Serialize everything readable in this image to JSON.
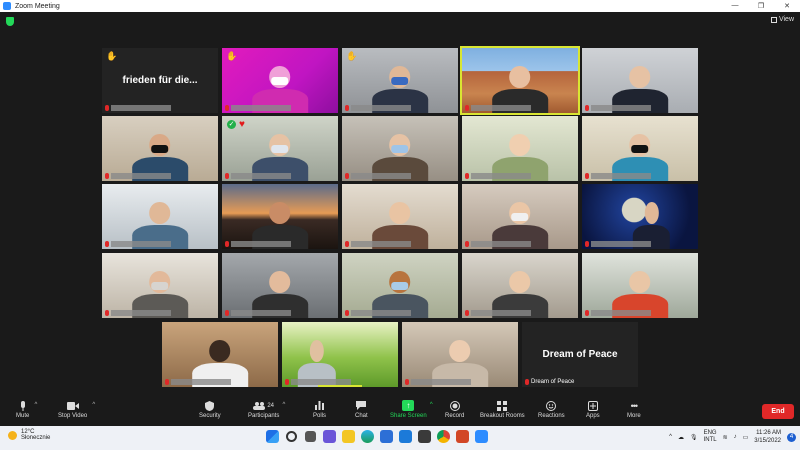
{
  "window": {
    "title": "Zoom Meeting"
  },
  "top_bar": {
    "view_label": "View"
  },
  "tiles": [
    {
      "id": "t1",
      "text": "frieden für die...",
      "hand": true
    },
    {
      "id": "t2",
      "hand": true
    },
    {
      "id": "t3",
      "hand": true
    },
    {
      "id": "t4",
      "active": true
    },
    {
      "id": "t5"
    },
    {
      "id": "t6"
    },
    {
      "id": "t7",
      "reactions": true
    },
    {
      "id": "t8"
    },
    {
      "id": "t9"
    },
    {
      "id": "t10"
    },
    {
      "id": "t11"
    },
    {
      "id": "t12"
    },
    {
      "id": "t13"
    },
    {
      "id": "t14"
    },
    {
      "id": "t15"
    },
    {
      "id": "t16"
    },
    {
      "id": "t17"
    },
    {
      "id": "t18"
    },
    {
      "id": "t19"
    },
    {
      "id": "t20"
    },
    {
      "id": "t21"
    },
    {
      "id": "t22"
    },
    {
      "id": "t23"
    },
    {
      "id": "t24",
      "text": "Dream of Peace",
      "name": "Dream of Peace"
    }
  ],
  "toolbar": {
    "mute": "Mute",
    "stop_video": "Stop Video",
    "security": "Security",
    "participants": "Participants",
    "participants_count": "24",
    "polls": "Polls",
    "chat": "Chat",
    "share_screen": "Share Screen",
    "record": "Record",
    "breakout_rooms": "Breakout Rooms",
    "reactions": "Reactions",
    "apps": "Apps",
    "more": "More",
    "end": "End"
  },
  "taskbar": {
    "weather_temp": "12°C",
    "weather_desc": "Słonecznie",
    "lang_top": "ENG",
    "lang_bottom": "INTL",
    "time": "11:26 AM",
    "date": "3/15/2022",
    "notif_count": "4"
  },
  "colors": {
    "accent_green": "#23d959",
    "end_red": "#e02828",
    "active_speaker": "#d9e632",
    "zoom_blue": "#2d8cff"
  }
}
